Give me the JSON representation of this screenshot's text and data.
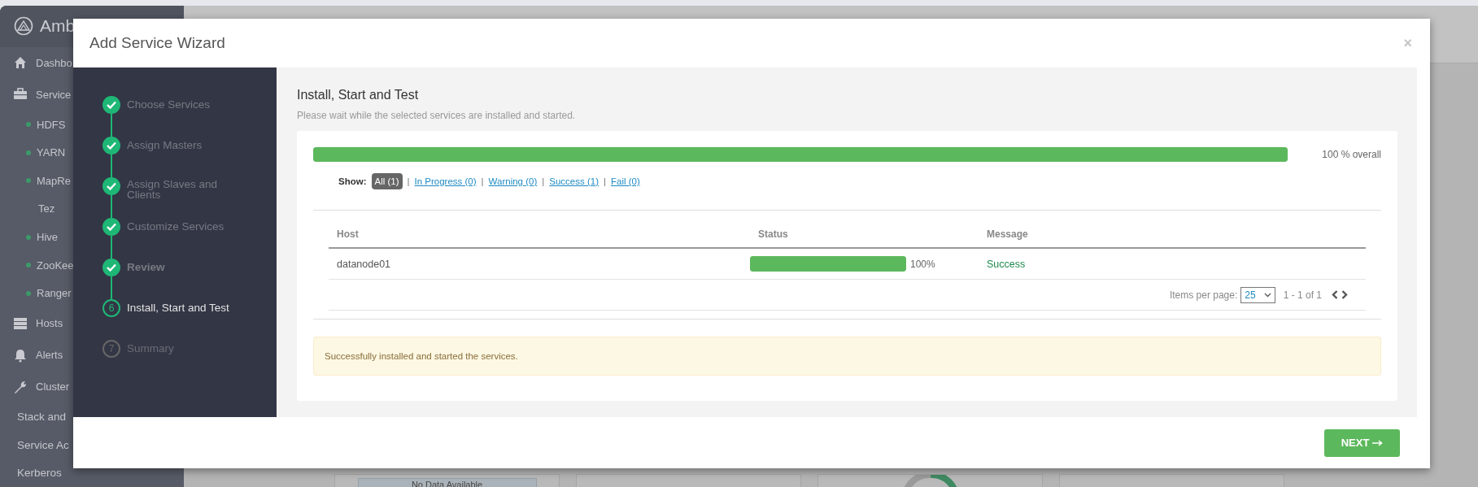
{
  "app_sidebar": {
    "logo_text": "Amb",
    "items": [
      {
        "kind": "main",
        "label": "Dashbo"
      },
      {
        "kind": "main",
        "label": "Service"
      },
      {
        "kind": "service",
        "label": "HDFS"
      },
      {
        "kind": "service",
        "label": "YARN"
      },
      {
        "kind": "service",
        "label": "MapRe"
      },
      {
        "kind": "plain",
        "label": "Tez"
      },
      {
        "kind": "service",
        "label": "Hive"
      },
      {
        "kind": "service",
        "label": "ZooKee"
      },
      {
        "kind": "service",
        "label": "Ranger"
      },
      {
        "kind": "main",
        "label": "Hosts"
      },
      {
        "kind": "main",
        "label": "Alerts"
      },
      {
        "kind": "main",
        "label": "Cluster"
      },
      {
        "kind": "sub",
        "label": "Stack and"
      },
      {
        "kind": "sub",
        "label": "Service Ac"
      },
      {
        "kind": "sub",
        "label": "Kerberos"
      }
    ]
  },
  "background_widget": {
    "empty_text": "No Data Available"
  },
  "modal": {
    "title": "Add Service Wizard",
    "close": "×",
    "steps": [
      {
        "label": "Choose Services",
        "done": true,
        "current": false,
        "bold": false
      },
      {
        "label": "Assign Masters",
        "done": true,
        "current": false,
        "bold": false
      },
      {
        "label": "Assign Slaves and Clients",
        "done": true,
        "current": false,
        "bold": false
      },
      {
        "label": "Customize Services",
        "done": true,
        "current": false,
        "bold": false
      },
      {
        "label": "Review",
        "done": true,
        "current": false,
        "bold": true
      },
      {
        "number": "6",
        "label": "Install, Start and Test",
        "done": false,
        "current": true,
        "bold": false
      },
      {
        "number": "7",
        "label": "Summary",
        "done": false,
        "current": false,
        "bold": false
      }
    ],
    "heading": "Install, Start and Test",
    "description": "Please wait while the selected services are installed and started.",
    "overall": {
      "level": 1,
      "reading": "100 % overall"
    },
    "filters": {
      "label": "Show:",
      "separator": "|",
      "options": [
        {
          "label": "All (1)",
          "selected": true
        },
        {
          "label": "In Progress (0)",
          "selected": false
        },
        {
          "label": "Warning (0)",
          "selected": false
        },
        {
          "label": "Success (1)",
          "selected": false
        },
        {
          "label": "Fail (0)",
          "selected": false
        }
      ]
    },
    "table": {
      "columns": [
        "Host",
        "Status",
        "Message"
      ],
      "rows": [
        {
          "host": "datanode01",
          "level": 1,
          "reading": "100%",
          "message": "Success",
          "success": true
        }
      ]
    },
    "pagination": {
      "label": "Items per page:",
      "page_size": "25",
      "range": "1 - 1 of 1"
    },
    "alert": "Successfully installed and started the services.",
    "next_button": "NEXT"
  }
}
